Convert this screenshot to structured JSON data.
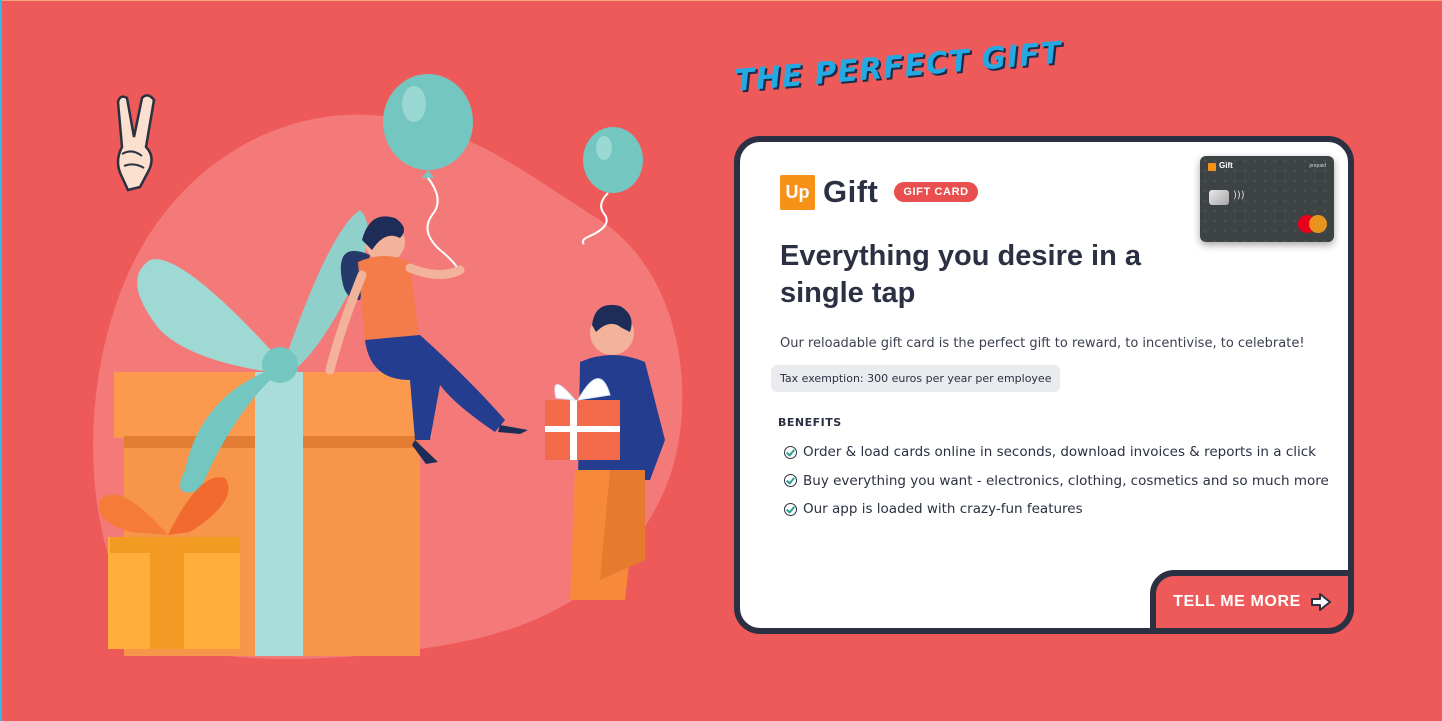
{
  "hero": {
    "headline": "THE PERFECT GIFT"
  },
  "colors": {
    "background": "#ee5a5a",
    "accent_blue": "#25a9e3",
    "card_border": "#2b3142",
    "brand_orange": "#f79219",
    "badge_red": "#e94f4f",
    "teal": "#74c6c0"
  },
  "card": {
    "logo_text": "Up",
    "brand_name": "Gift",
    "badge": "GIFT CARD",
    "payment_card": {
      "brand": "Gift",
      "type": "prepaid"
    },
    "title": "Everything you desire in a single tap",
    "description": "Our reloadable gift card is the perfect gift to reward, to incentivise, to celebrate!",
    "tax_note": "Tax exemption: 300 euros per year per employee",
    "benefits_heading": "BENEFITS",
    "benefits": [
      "Order & load cards online in seconds, download invoices & reports in a click",
      "Buy everything you want - electronics, clothing, cosmetics and so much more",
      "Our app is loaded with crazy-fun features"
    ],
    "cta_label": "TELL ME MORE",
    "cta_icon": "arrow-right-icon"
  },
  "illustration": {
    "icons": [
      "peace-hand-icon",
      "balloon-icon",
      "gift-box-icon"
    ]
  }
}
